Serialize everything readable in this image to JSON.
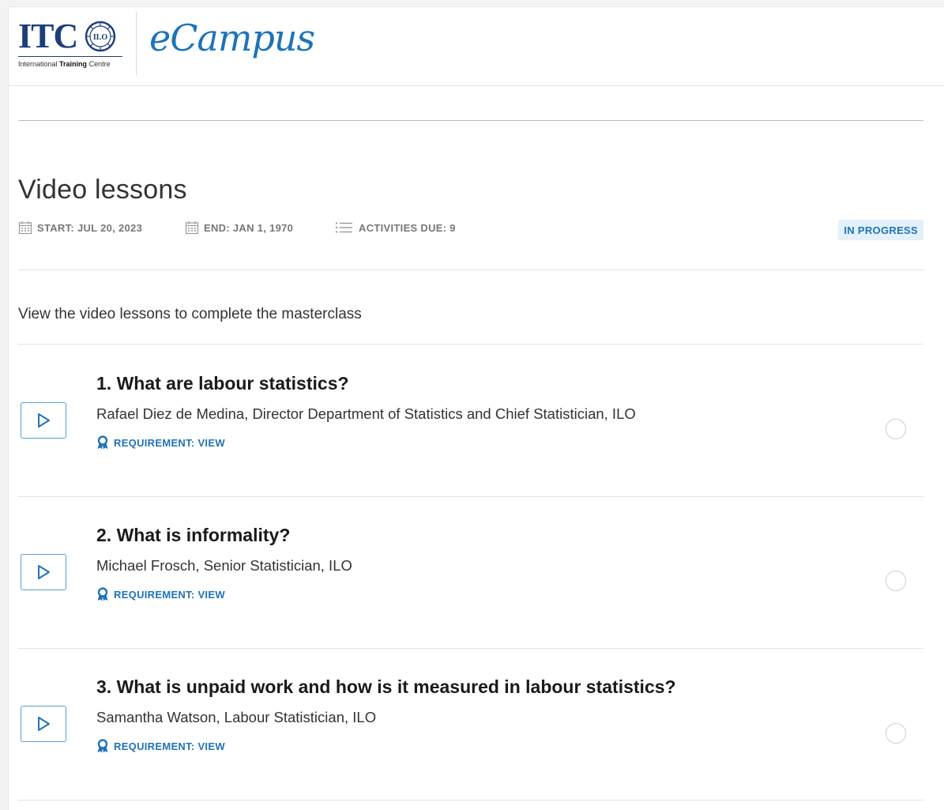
{
  "header": {
    "itc_logo_text": "ITC",
    "itc_logo_subtitle_pre": "International ",
    "itc_logo_subtitle_bold": "Training",
    "itc_logo_subtitle_post": " Centre",
    "seal_text": "ILO",
    "brand": "eCampus"
  },
  "module": {
    "title": "Video lessons",
    "start": "START: JUL 20, 2023",
    "end": "END: JAN 1, 1970",
    "activities_due": "ACTIVITIES DUE: 9",
    "status": "IN PROGRESS",
    "description": "View the video lessons to complete the masterclass"
  },
  "lessons": [
    {
      "title": "1. What are labour statistics?",
      "author": "Rafael Diez de Medina, Director Department of Statistics and Chief Statistician, ILO",
      "requirement": "REQUIREMENT: VIEW"
    },
    {
      "title": "2. What is informality?",
      "author": "Michael Frosch, Senior Statistician, ILO",
      "requirement": "REQUIREMENT: VIEW"
    },
    {
      "title": "3. What is unpaid work and how is it measured in labour statistics?",
      "author": "Samantha Watson, Labour Statistician, ILO",
      "requirement": "REQUIREMENT: VIEW"
    }
  ],
  "colors": {
    "accent": "#1e73b8",
    "badge_bg": "#e4f1fb",
    "logo_navy": "#1d3e7a"
  },
  "icons": {
    "calendar": "calendar-icon",
    "list": "list-icon",
    "play": "play-icon",
    "award": "award-icon",
    "completion": "completion-circle-icon"
  }
}
